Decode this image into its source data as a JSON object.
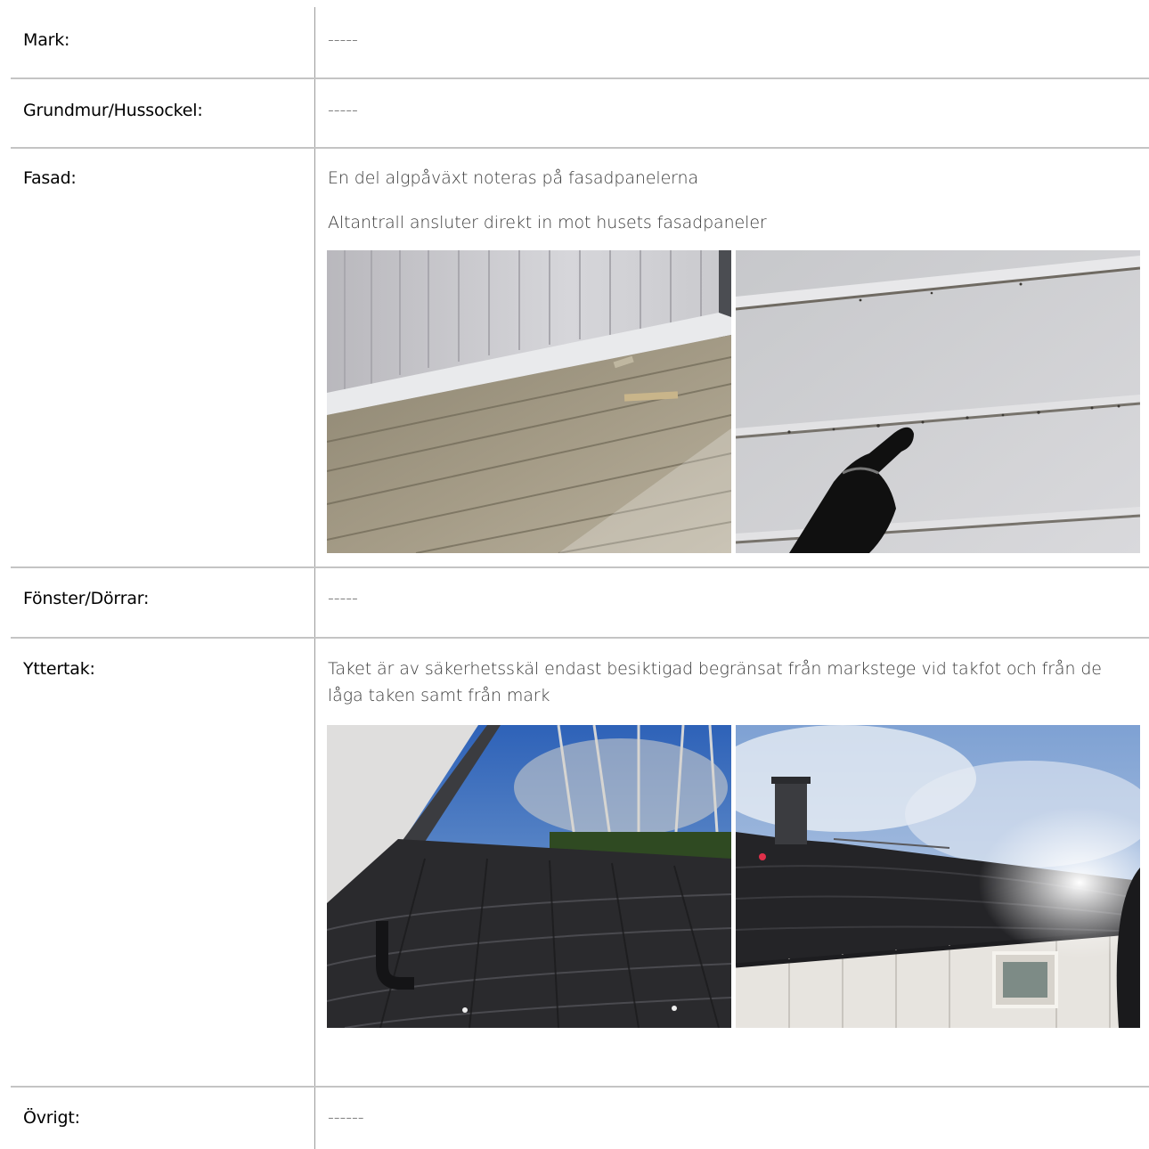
{
  "rows": {
    "mark": {
      "label": "Mark:",
      "value": "-----"
    },
    "grundmur": {
      "label": "Grundmur/Hussockel:",
      "value": "-----"
    },
    "fasad": {
      "label": "Fasad:",
      "notes": [
        "En del algpåväxt noteras på fasadpanelerna",
        "Altantrall ansluter direkt in mot husets fasadpaneler"
      ]
    },
    "fonster": {
      "label": "Fönster/Dörrar:",
      "value": "-----"
    },
    "yttertak": {
      "label": "Yttertak:",
      "note": "Taket är av säkerhetsskäl endast besiktigad begränsat från markstege vid takfot och från de låga taken samt från mark"
    },
    "ovrigt": {
      "label": "Övrigt:",
      "value": "------"
    }
  }
}
